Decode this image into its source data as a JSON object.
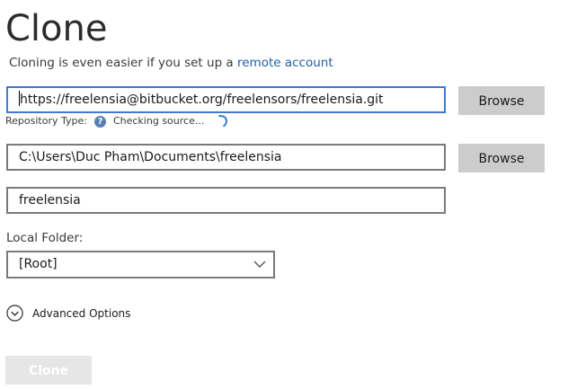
{
  "header": {
    "title": "Clone",
    "subtitle_text": "Cloning is even easier if you set up a ",
    "subtitle_link": "remote account"
  },
  "source": {
    "value": "https://freelensia@bitbucket.org/freelensors/freelensia.git",
    "browse_label": "Browse"
  },
  "repo_type": {
    "label": "Repository Type:",
    "help_icon": "?",
    "status": "Checking source..."
  },
  "destination": {
    "value": "C:\\Users\\Duc Pham\\Documents\\freelensia",
    "browse_label": "Browse"
  },
  "name": {
    "value": "freelensia"
  },
  "local_folder": {
    "label": "Local Folder:",
    "selected": "[Root]"
  },
  "advanced": {
    "label": "Advanced Options"
  },
  "actions": {
    "clone_label": "Clone"
  },
  "colors": {
    "accent_link": "#1f5fa8",
    "focus_border": "#3e7bd1",
    "spinner": "#2f7fd6",
    "button_bg": "#cccccc",
    "disabled_button_bg": "#e6e6e6"
  },
  "icons": {
    "help": "help-icon",
    "spinner": "spinner-icon",
    "dropdown": "chevron-down-icon",
    "advanced_toggle": "circle-chevron-down-icon"
  }
}
